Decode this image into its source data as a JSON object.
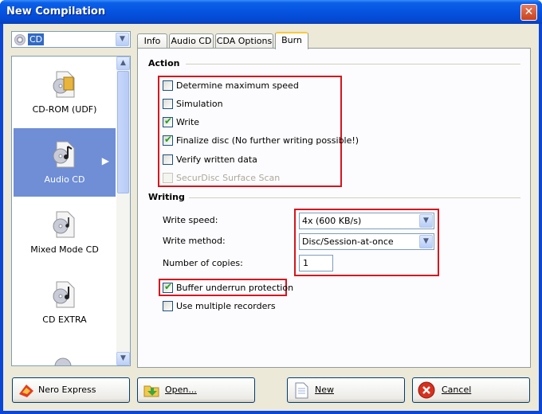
{
  "window": {
    "title": "New Compilation",
    "close_glyph": "✕"
  },
  "disc_type": {
    "selected": "CD"
  },
  "compilation_types": [
    {
      "label": "CD-ROM (UDF)",
      "icon": "cd-rom-icon",
      "selected": false
    },
    {
      "label": "Audio CD",
      "icon": "audio-cd-icon",
      "selected": true
    },
    {
      "label": "Mixed Mode CD",
      "icon": "mixed-mode-cd-icon",
      "selected": false
    },
    {
      "label": "CD EXTRA",
      "icon": "cd-extra-icon",
      "selected": false
    }
  ],
  "tabs": [
    {
      "label": "Info",
      "active": false
    },
    {
      "label": "Audio CD",
      "active": false
    },
    {
      "label": "CDA Options",
      "active": false
    },
    {
      "label": "Burn",
      "active": true
    }
  ],
  "burn": {
    "action": {
      "title": "Action",
      "options": [
        {
          "label": "Determine maximum speed",
          "checked": false,
          "enabled": true
        },
        {
          "label": "Simulation",
          "checked": false,
          "enabled": true
        },
        {
          "label": "Write",
          "checked": true,
          "enabled": true
        },
        {
          "label": "Finalize disc (No further writing possible!)",
          "checked": true,
          "enabled": true
        },
        {
          "label": "Verify written data",
          "checked": false,
          "enabled": true
        },
        {
          "label": "SecurDisc Surface Scan",
          "checked": false,
          "enabled": false
        }
      ]
    },
    "writing": {
      "title": "Writing",
      "write_speed_label": "Write speed:",
      "write_speed_value": "4x (600 KB/s)",
      "write_method_label": "Write method:",
      "write_method_value": "Disc/Session-at-once",
      "copies_label": "Number of copies:",
      "copies_value": "1",
      "buffer_underrun_label": "Buffer underrun protection",
      "buffer_underrun_checked": true,
      "multiple_recorders_label": "Use multiple recorders",
      "multiple_recorders_checked": false
    }
  },
  "buttons": {
    "nero_express": "Nero Express",
    "open": "Open...",
    "new": "New",
    "cancel": "Cancel"
  },
  "colors": {
    "highlight": "#d7141e",
    "selection": "#6f8ed6",
    "checkmark": "#21a121"
  }
}
